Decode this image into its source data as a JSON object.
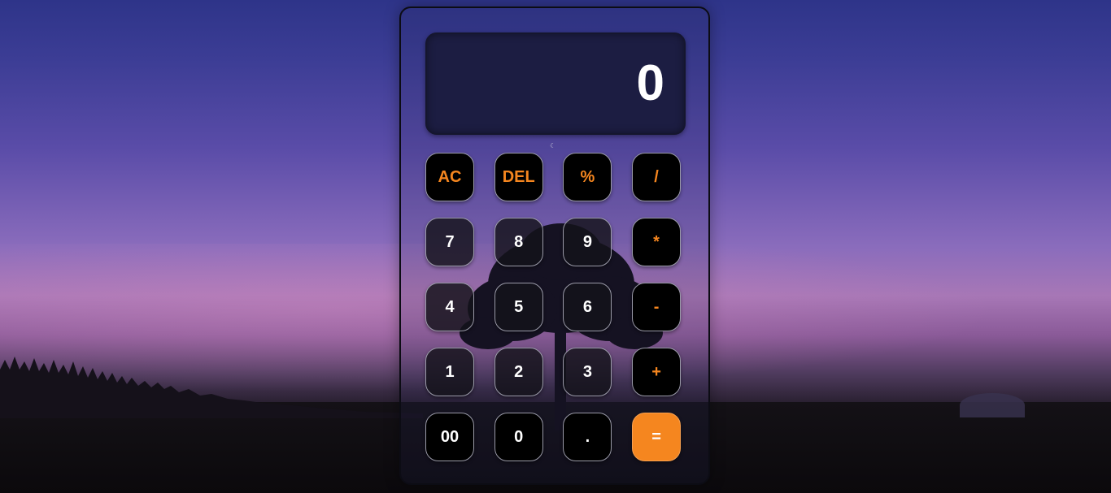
{
  "calculator": {
    "display": {
      "value": "0"
    },
    "keys": {
      "row1": [
        "AC",
        "DEL",
        "%",
        "/"
      ],
      "row2": [
        "7",
        "8",
        "9",
        "*"
      ],
      "row3": [
        "4",
        "5",
        "6",
        "-"
      ],
      "row4": [
        "1",
        "2",
        "3",
        "+"
      ],
      "row5": [
        "00",
        "0",
        ".",
        "="
      ]
    }
  },
  "colors": {
    "accent": "#f5861f",
    "key_background": "#000000",
    "display_background": "#1c1d42",
    "key_text": "#ffffff"
  }
}
